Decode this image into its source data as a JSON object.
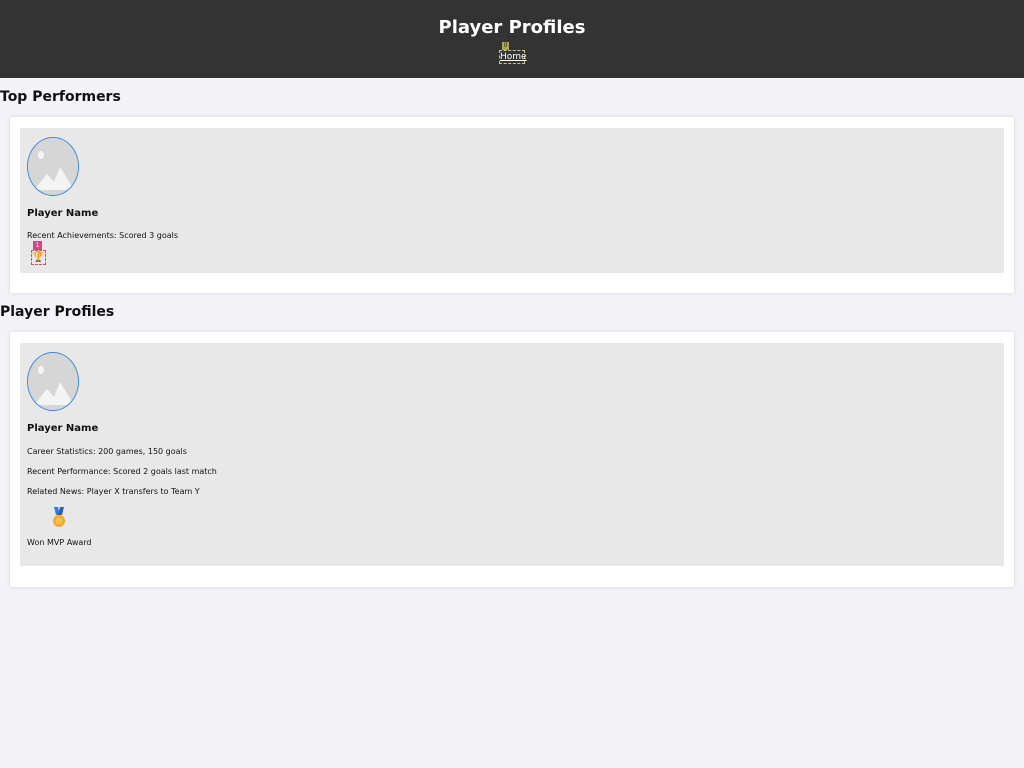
{
  "header": {
    "title": "Player Profiles",
    "nav_marker": "0",
    "nav_home_label": "Home"
  },
  "top_performers": {
    "title": "Top Performers",
    "player": {
      "avatar_icon": "image-placeholder-icon",
      "name": "Player Name",
      "achievements": "Recent Achievements: Scored 3 goals",
      "badge_count": "1",
      "badge_icon": "trophy-icon"
    }
  },
  "player_profiles": {
    "title": "Player Profiles",
    "player": {
      "avatar_icon": "image-placeholder-icon",
      "name": "Player Name",
      "career_stats": "Career Statistics: 200 games, 150 goals",
      "recent_performance": "Recent Performance: Scored 2 goals last match",
      "related_news": "Related News: Player X transfers to Team Y",
      "award_icon": "medal-icon",
      "award_label": "Won MVP Award"
    }
  },
  "colors": {
    "header_bg": "#333333",
    "page_bg": "#f4f4f8",
    "card_bg": "#e8e8e8",
    "avatar_border": "#3a86e0",
    "badge": "#d04a8a"
  }
}
